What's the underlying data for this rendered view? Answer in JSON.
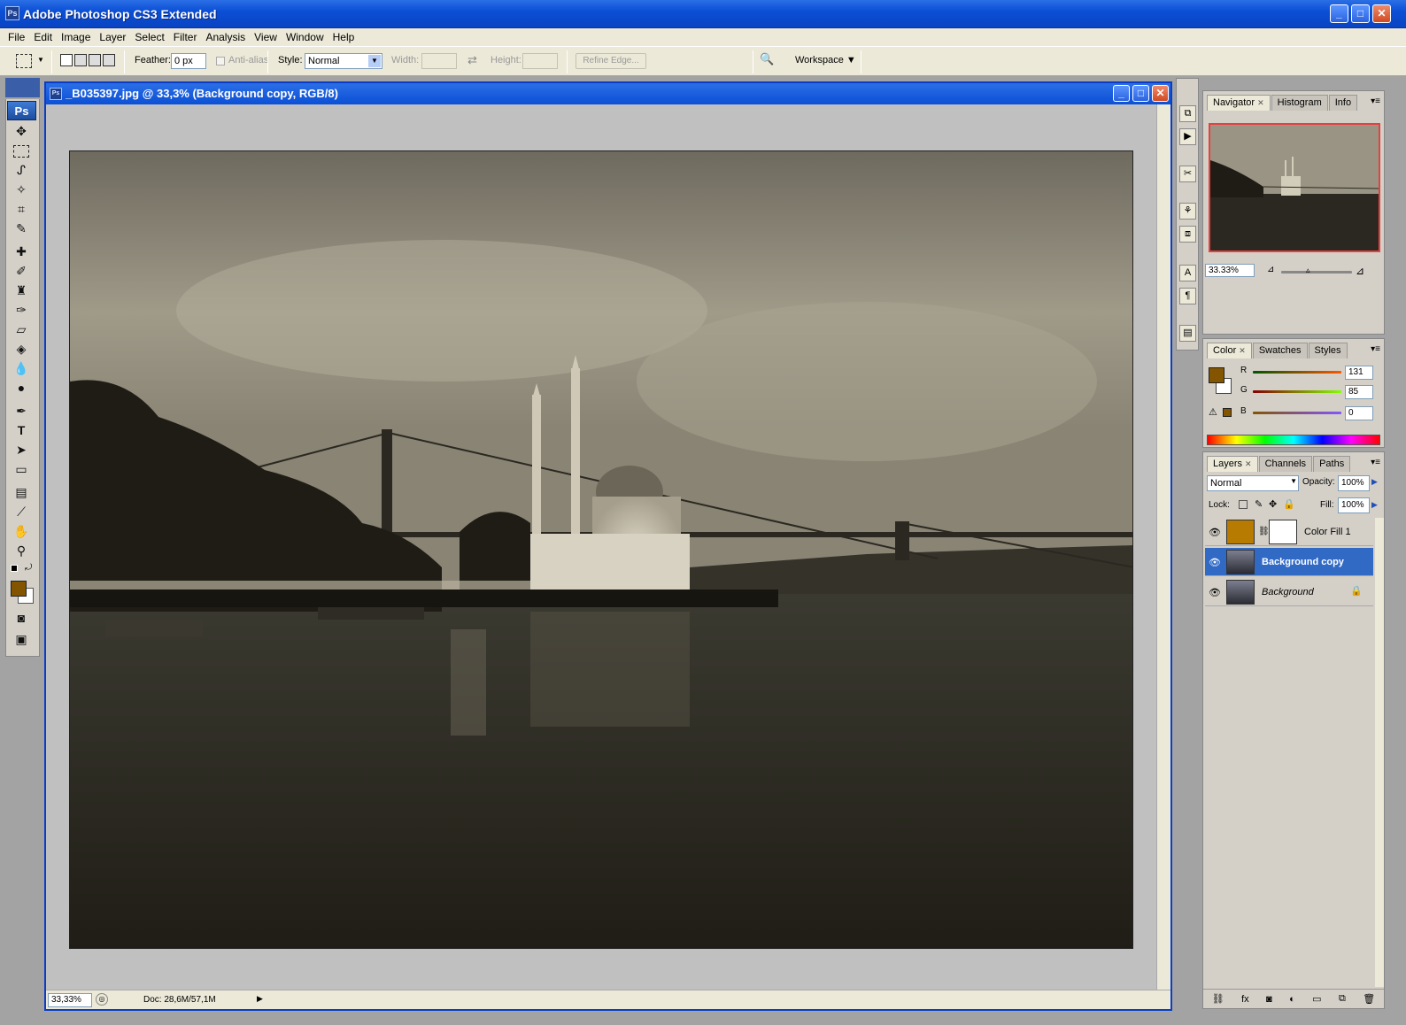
{
  "app": {
    "title": "Adobe Photoshop CS3 Extended",
    "icon_text": "Ps"
  },
  "menu": [
    "File",
    "Edit",
    "Image",
    "Layer",
    "Select",
    "Filter",
    "Analysis",
    "View",
    "Window",
    "Help"
  ],
  "options": {
    "feather_label": "Feather:",
    "feather_value": "0 px",
    "antialias_label": "Anti-alias",
    "style_label": "Style:",
    "style_value": "Normal",
    "width_label": "Width:",
    "height_label": "Height:",
    "refine_edge": "Refine Edge...",
    "workspace": "Workspace ▼"
  },
  "toolbox": {
    "logo": "Ps",
    "foreground_color": "#835500"
  },
  "document": {
    "title": "_B035397.jpg @ 33,3% (Background copy, RGB/8)",
    "status_zoom": "33,33%",
    "status_doc": "Doc: 28,6M/57,1M"
  },
  "navigator": {
    "tabs": [
      "Navigator",
      "Histogram",
      "Info"
    ],
    "zoom": "33.33%"
  },
  "color_panel": {
    "tabs": [
      "Color",
      "Swatches",
      "Styles"
    ],
    "r_label": "R",
    "r": "131",
    "g_label": "G",
    "g": "85",
    "b_label": "B",
    "b": "0",
    "swatch": "#835500"
  },
  "layers_panel": {
    "tabs": [
      "Layers",
      "Channels",
      "Paths"
    ],
    "blend": "Normal",
    "opacity_label": "Opacity:",
    "opacity": "100%",
    "lock_label": "Lock:",
    "fill_label": "Fill:",
    "fill": "100%",
    "layers": [
      {
        "name": "Color Fill 1"
      },
      {
        "name": "Background copy"
      },
      {
        "name": "Background"
      }
    ]
  }
}
